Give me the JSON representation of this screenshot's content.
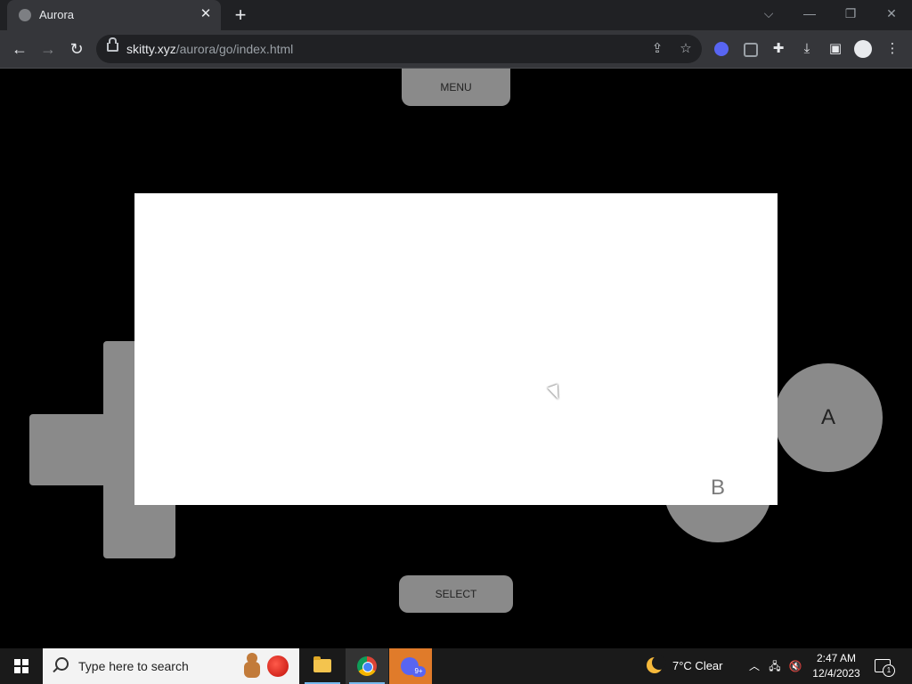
{
  "browser": {
    "tab": {
      "title": "Aurora",
      "close_glyph": "✕"
    },
    "new_tab_glyph": "+",
    "window_controls": {
      "tabsearch_glyph": "⌵",
      "minimize_glyph": "—",
      "restore_glyph": "❐",
      "close_glyph": "✕"
    },
    "nav": {
      "back_glyph": "←",
      "forward_glyph": "→",
      "reload_glyph": "↻"
    },
    "address": {
      "domain": "skitty.xyz",
      "path": "/aurora/go/index.html"
    },
    "icons": {
      "share": "share-icon",
      "star": "star-icon",
      "discord_ext": "discord-extension-icon",
      "ext2": "extension-box-icon",
      "puzzle": "puzzle-icon",
      "download": "download-icon",
      "sidepanel": "side-panel-icon",
      "profile": "profile-icon",
      "more": "more-icon"
    },
    "glyphs": {
      "share": "⇪",
      "star": "☆",
      "puzzle": "✚",
      "download": "⤓",
      "sidepanel": "▣",
      "profile": "●",
      "more": "⋮"
    }
  },
  "game": {
    "menu_label": "MENU",
    "select_label": "SELECT",
    "a_label": "A",
    "b_label": "B"
  },
  "taskbar": {
    "search_placeholder": "Type here to search",
    "weather": {
      "temp": "7°C",
      "condition": "Clear",
      "text": "7°C  Clear"
    },
    "tray_glyphs": {
      "chevron": "︿",
      "network": "🖧",
      "volume": "🔇"
    },
    "clock": {
      "time": "2:47 AM",
      "date": "12/4/2023"
    },
    "notification_count": "1",
    "discord_badge": "9+"
  },
  "colors": {
    "tab_bg": "#35363a",
    "tabstrip_bg": "#202124",
    "game_button": "#8a8a8a",
    "screen": "#ffffff",
    "page_bg": "#000000",
    "taskbar_bg": "#1a1a1a"
  }
}
